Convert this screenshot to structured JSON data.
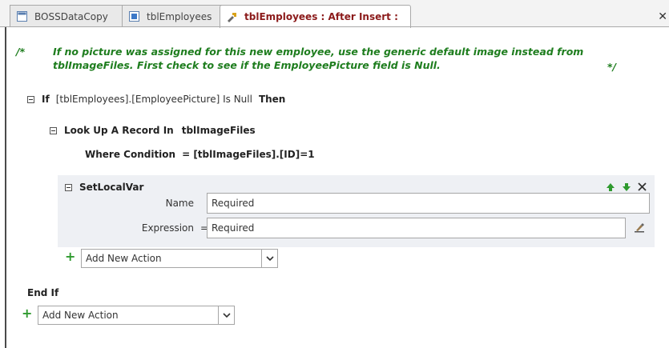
{
  "tabs": [
    {
      "label": "BOSSDataCopy",
      "icon": "database-icon"
    },
    {
      "label": "tblEmployees",
      "icon": "table-icon"
    },
    {
      "label": "tblEmployees : After Insert :",
      "icon": "macro-icon",
      "active": true
    }
  ],
  "close_glyph": "✕",
  "comment": {
    "open": "/*",
    "text": "If no picture was assigned for this new employee, use the generic default image instead from tblImageFiles. First check to see if the EmployeePicture field is Null.",
    "close": "*/"
  },
  "if_block": {
    "keyword": "If",
    "condition": "[tblEmployees].[EmployeePicture] Is Null",
    "then": "Then"
  },
  "lookup": {
    "label": "Look Up A Record In",
    "table": "tblImageFiles",
    "where_label": "Where Condition",
    "where_value": "= [tblImageFiles].[ID]=1"
  },
  "set_local_var": {
    "title": "SetLocalVar",
    "name_label": "Name",
    "name_value": "Required",
    "expr_label": "Expression",
    "expr_eq": "=",
    "expr_value": "Required"
  },
  "inner_add_action": "Add New Action",
  "end_if": "End If",
  "outer_add_action": "Add New Action",
  "colors": {
    "comment": "#1e7d1e",
    "active_tab_text": "#8b1a1a",
    "block_bg": "#eef0f4",
    "plus": "#2f9a2f"
  }
}
